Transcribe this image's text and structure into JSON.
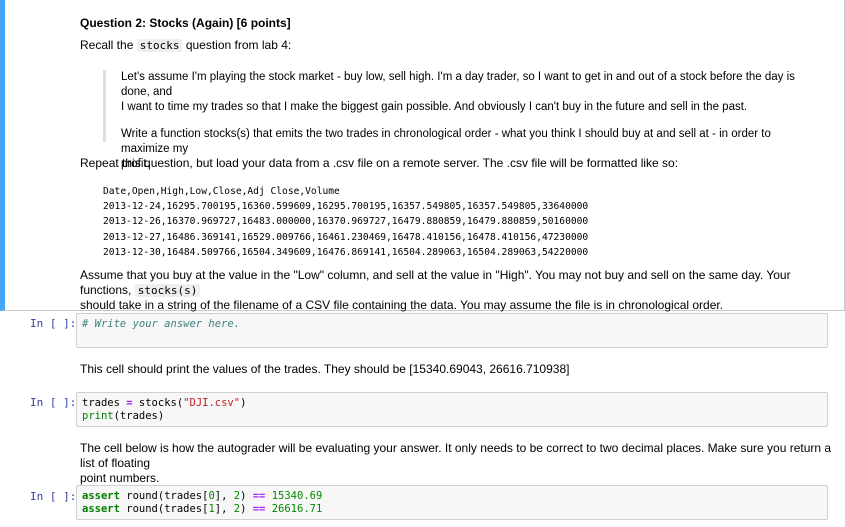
{
  "question": {
    "title": "Question 2: Stocks (Again) [6 points]",
    "recall_prefix": "Recall the",
    "recall_code": "stocks",
    "recall_suffix": "question from lab 4:",
    "quote_p1_line1": "Let's assume I'm playing the stock market - buy low, sell high. I'm a day trader, so I want to get in and out of a stock before the day is done, and",
    "quote_p1_line2": "I want to time my trades so that I make the biggest gain possible. And obviously I can't buy in the future and sell in the past.",
    "quote_p2_line1": "Write a function stocks(s) that emits the two trades in chronological order - what you think I should buy at and sell at - in order to maximize my",
    "quote_p2_line2": "profit.",
    "repeat_text": "Repeat this question, but load your data from a .csv file on a remote server. The .csv file will be formatted like so:",
    "csv_lines": [
      "Date,Open,High,Low,Close,Adj Close,Volume",
      "2013-12-24,16295.700195,16360.599609,16295.700195,16357.549805,16357.549805,33640000",
      "2013-12-26,16370.969727,16483.000000,16370.969727,16479.880859,16479.880859,50160000",
      "2013-12-27,16486.369141,16529.009766,16461.230469,16478.410156,16478.410156,47230000",
      "2013-12-30,16484.509766,16504.349609,16476.869141,16504.289063,16504.289063,54220000"
    ],
    "assume_line1_text": "Assume that you buy at the value in the \"Low\" column, and sell at the value in \"High\". You may not buy and sell on the same day. Your functions,",
    "assume_code": "stocks(s)",
    "assume_line2": "should take in a string of the filename of a CSV file containing the data. You may assume the file is in chronological order."
  },
  "cells": {
    "prompt": "In [ ]:",
    "cell1_comment": "# Write your answer here.",
    "print_note": "This cell should print the values of the trades. They should be [15340.69043, 26616.710938]",
    "cell2_line1": {
      "a": "trades ",
      "op": "=",
      "b": " stocks(",
      "str": "\"DJI.csv\"",
      "c": ")"
    },
    "cell2_line2": {
      "bi": "print",
      "rest": "(trades)"
    },
    "autograder_line1": "The cell below is how the autograder will be evaluating your answer. It only needs to be correct to two decimal places. Make sure you return a list of floating",
    "autograder_line2": "point numbers.",
    "cell3_line1": {
      "kw": "assert",
      "a": " round(trades[",
      "n0": "0",
      "b": "], ",
      "n1": "2",
      "c": ") ",
      "op": "==",
      "d": " ",
      "val": "15340.69"
    },
    "cell3_line2": {
      "kw": "assert",
      "a": " round(trades[",
      "n0": "1",
      "b": "], ",
      "n1": "2",
      "c": ") ",
      "op": "==",
      "d": " ",
      "val": "26616.71"
    }
  }
}
